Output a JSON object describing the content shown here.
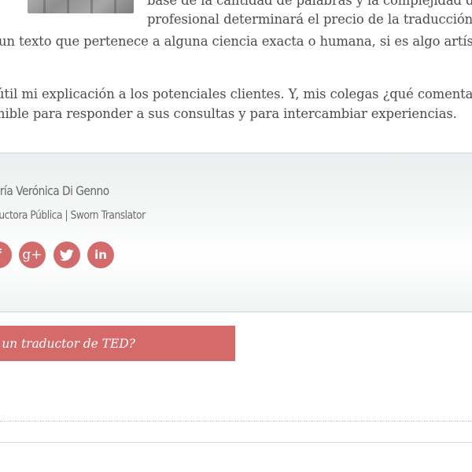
{
  "article": {
    "line1": "base de la cantidad de palabras y la complejidad de",
    "line2": "profesional determinará el precio de la traducción.",
    "line3": "un texto que pertenece a alguna ciencia exacta o humana, si es algo artístico",
    "line4": "útil mi explicación a los potenciales clientes. Y,  mis colegas ¿qué comentario",
    "line5": "nible para responder a sus consultas y para intercambiar experiencias."
  },
  "author": {
    "name": "aría Verónica Di Genno",
    "role": "aductora Pública | Sworn Translator"
  },
  "social": [
    {
      "name": "facebook",
      "icon": "facebook-icon",
      "glyph": "f"
    },
    {
      "name": "google-plus",
      "icon": "google-plus-icon",
      "glyph": "g+"
    },
    {
      "name": "twitter",
      "icon": "twitter-icon"
    },
    {
      "name": "linkedin",
      "icon": "linkedin-icon",
      "glyph": "in"
    }
  ],
  "navigation": {
    "next_post": "r un traductor de TED?"
  },
  "colors": {
    "accent": "#d56a6b",
    "text": "#4a4a4a",
    "author_box_border": "#cfd3d5"
  }
}
